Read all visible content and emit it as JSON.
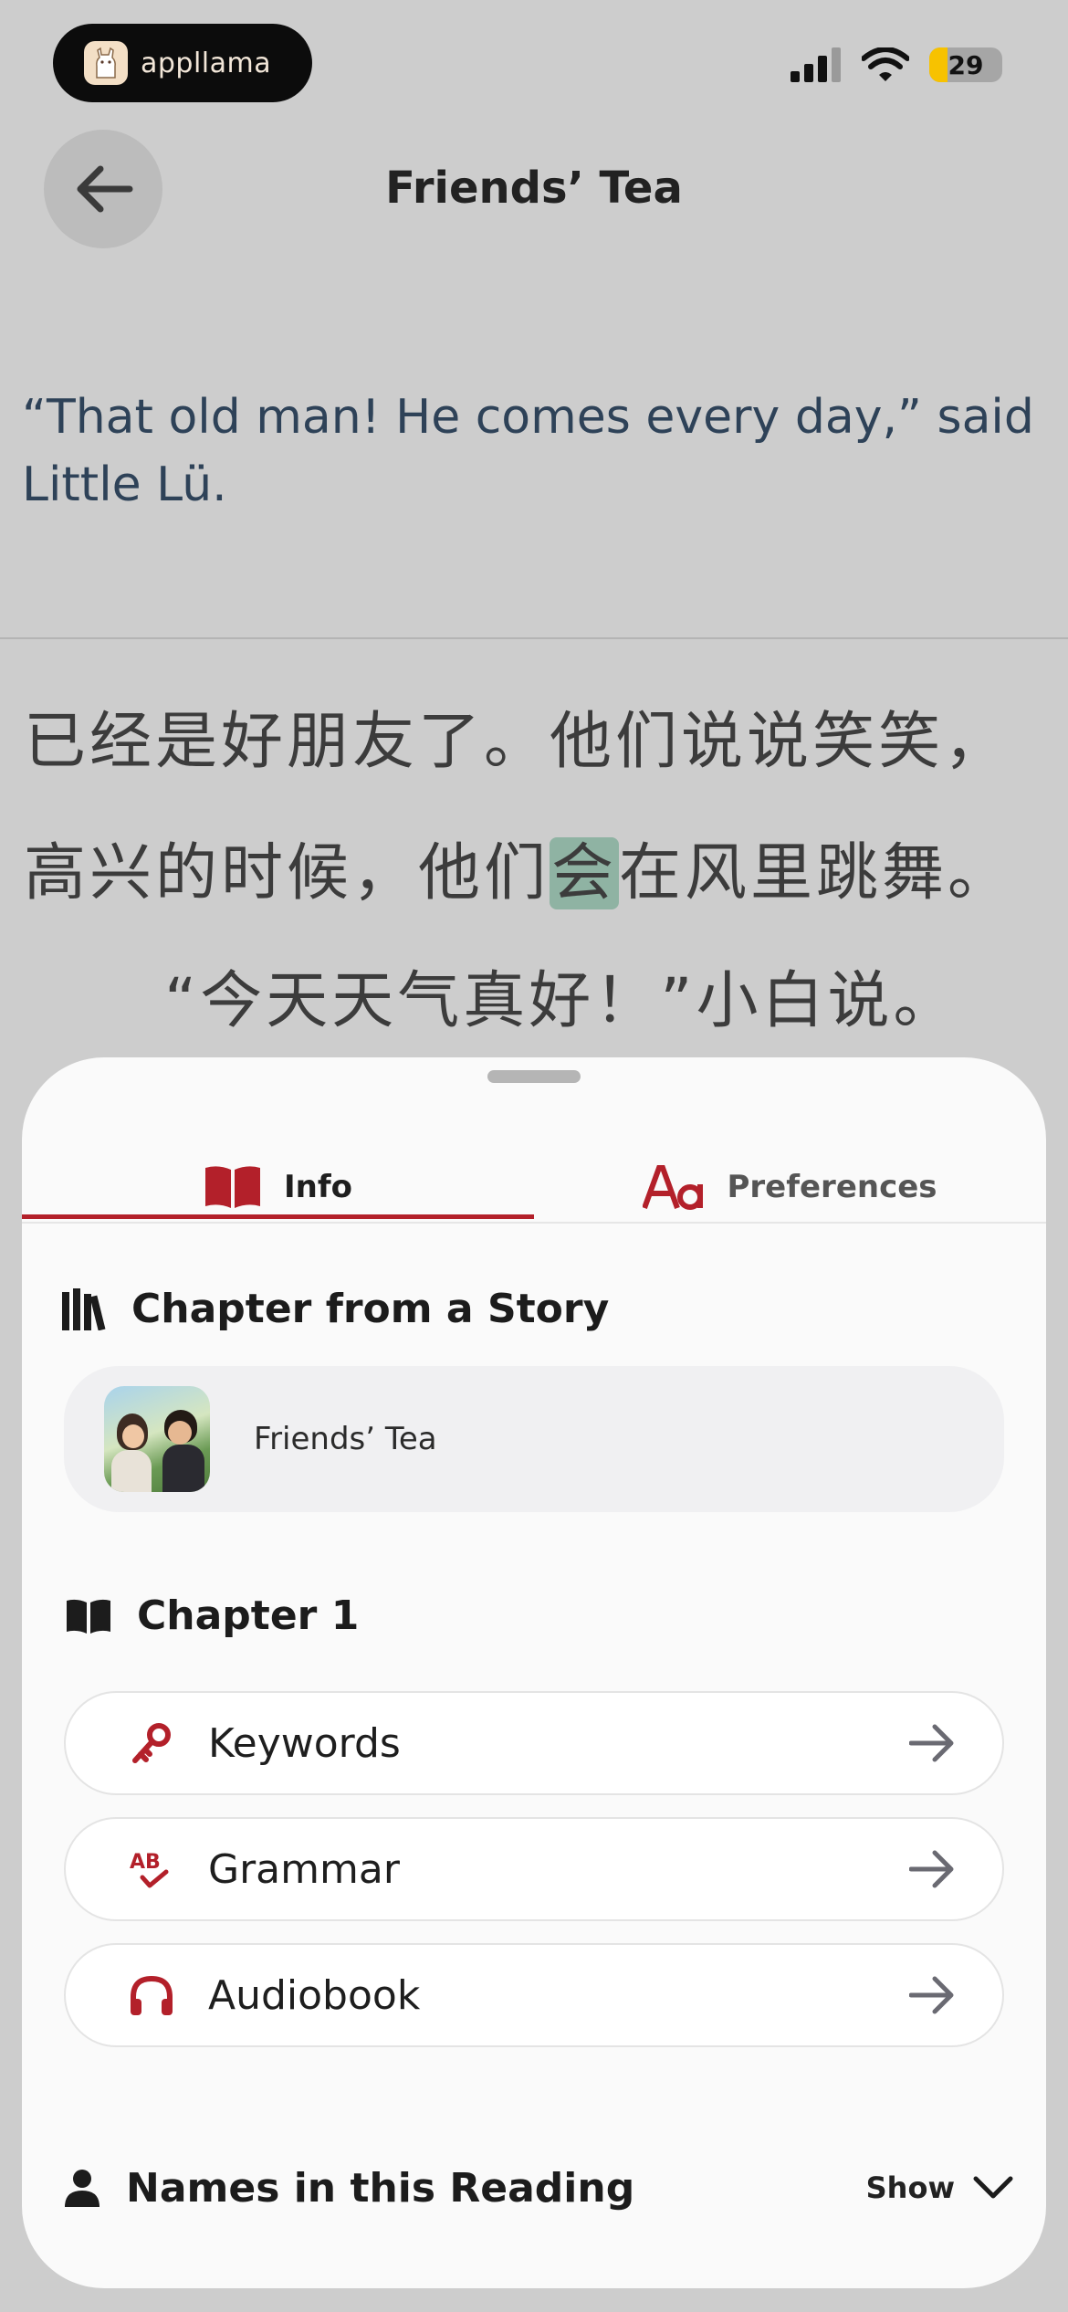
{
  "status_bar": {
    "app_badge": "appllama",
    "battery": "29",
    "colors": {
      "battery_fill": "#f7c200"
    }
  },
  "header": {
    "title": "Friends’ Tea"
  },
  "reading": {
    "translation": "“That old man! He comes every day,” said Little Lü.",
    "lines": [
      {
        "before": "已经是好朋友了。他们说说笑笑，",
        "highlight": "",
        "after": ""
      },
      {
        "before": "高兴的时候，他们",
        "highlight": "会",
        "after": "在风里跳舞。"
      },
      {
        "before": "“今天天气真好！”小白说。",
        "highlight": "",
        "after": ""
      }
    ],
    "colors": {
      "highlight": "#8fb3a3",
      "translation": "#2e4258"
    }
  },
  "sheet": {
    "tabs": [
      {
        "label": "Info",
        "icon": "book-open-icon",
        "active": true
      },
      {
        "label": "Preferences",
        "icon": "font-aa-icon",
        "active": false
      }
    ],
    "story_section": {
      "heading": "Chapter from a Story",
      "icon": "library-icon",
      "story_title": "Friends’ Tea"
    },
    "chapter_section": {
      "heading": "Chapter 1",
      "icon": "book-icon",
      "items": [
        {
          "label": "Keywords",
          "icon": "key-icon"
        },
        {
          "label": "Grammar",
          "icon": "spellcheck-icon"
        },
        {
          "label": "Audiobook",
          "icon": "headphones-icon"
        }
      ]
    },
    "names_section": {
      "heading": "Names in this Reading",
      "icon": "person-icon",
      "toggle_label": "Show"
    },
    "colors": {
      "accent": "#b3202a"
    }
  }
}
